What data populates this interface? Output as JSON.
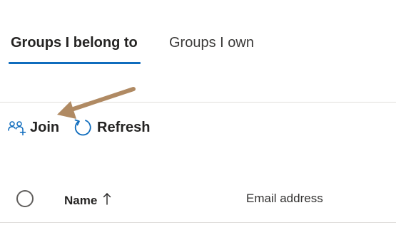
{
  "tabs": [
    {
      "label": "Groups I belong to",
      "active": true
    },
    {
      "label": "Groups I own",
      "active": false
    }
  ],
  "commands": {
    "join": {
      "label": "Join",
      "icon": "people-add-icon"
    },
    "refresh": {
      "label": "Refresh",
      "icon": "refresh-icon"
    }
  },
  "table": {
    "columns": [
      {
        "label": "Name",
        "sort": "ascending"
      },
      {
        "label": "Email address"
      }
    ]
  },
  "colors": {
    "accent": "#0f6cbd",
    "annotation_arrow": "#b08a63"
  }
}
